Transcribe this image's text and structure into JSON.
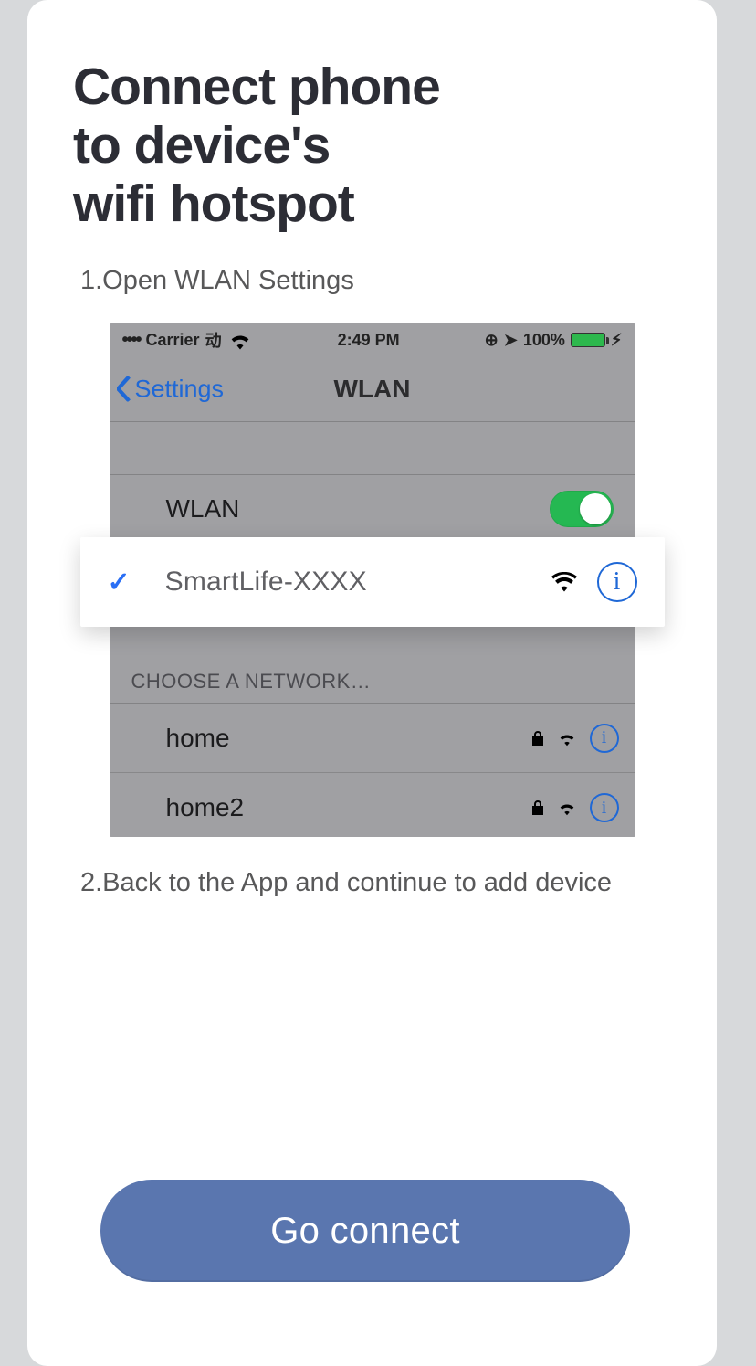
{
  "title_line1": "Connect phone",
  "title_line2": "to device's",
  "title_line3": "wifi hotspot",
  "step1": "1.Open WLAN Settings",
  "step2": "2.Back to the App and continue to add device",
  "statusbar": {
    "carrier": "Carrier",
    "carrier_suffix": "动",
    "time": "2:49 PM",
    "battery_pct": "100%"
  },
  "nav": {
    "back": "Settings",
    "title": "WLAN"
  },
  "wlan_label": "WLAN",
  "choose_label": "CHOOSE A NETWORK…",
  "networks": {
    "n1": "home",
    "n2": "home2"
  },
  "selected_network": "SmartLife-XXXX",
  "cta": "Go connect"
}
